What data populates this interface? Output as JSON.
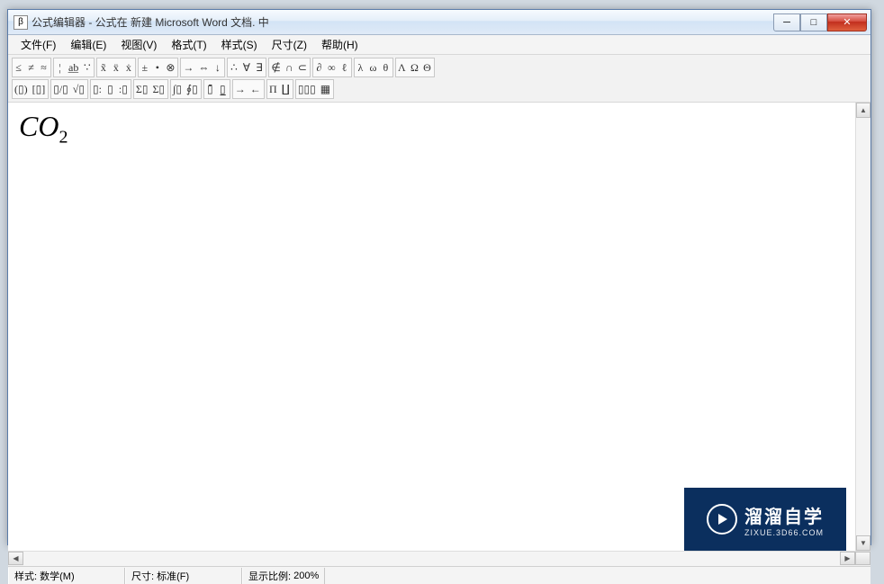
{
  "titlebar": {
    "icon_label": "formula-editor-icon",
    "title": "公式编辑器 - 公式在 新建 Microsoft Word 文档. 中"
  },
  "menubar": {
    "items": [
      {
        "label": "文件(F)"
      },
      {
        "label": "编辑(E)"
      },
      {
        "label": "视图(V)"
      },
      {
        "label": "格式(T)"
      },
      {
        "label": "样式(S)"
      },
      {
        "label": "尺寸(Z)"
      },
      {
        "label": "帮助(H)"
      }
    ]
  },
  "toolbar": {
    "row1": [
      {
        "name": "relational-ops",
        "symbols": [
          "≤",
          "≠",
          "≈"
        ]
      },
      {
        "name": "spaces-dots",
        "symbols": [
          "¦",
          "a̲b̲",
          "∵"
        ]
      },
      {
        "name": "embellishments",
        "symbols": [
          "x̃",
          "ẍ",
          "ẋ"
        ]
      },
      {
        "name": "operator-symbols",
        "symbols": [
          "±",
          "•",
          "⊗"
        ]
      },
      {
        "name": "arrows",
        "symbols": [
          "→",
          "⇔",
          "↓"
        ]
      },
      {
        "name": "logical",
        "symbols": [
          "∴",
          "∀",
          "∃"
        ]
      },
      {
        "name": "set-theory",
        "symbols": [
          "∉",
          "∩",
          "⊂"
        ]
      },
      {
        "name": "misc-symbols",
        "symbols": [
          "∂",
          "∞",
          "ℓ"
        ]
      },
      {
        "name": "greek-lower",
        "symbols": [
          "λ",
          "ω",
          "θ"
        ]
      },
      {
        "name": "greek-upper",
        "symbols": [
          "Λ",
          "Ω",
          "Θ"
        ]
      }
    ],
    "row2": [
      {
        "name": "fences",
        "symbols": [
          "(▯)",
          "[▯]"
        ]
      },
      {
        "name": "fractions-radicals",
        "symbols": [
          "▯/▯",
          "√▯"
        ]
      },
      {
        "name": "sub-super",
        "symbols": [
          "▯:",
          "▯",
          ":▯"
        ]
      },
      {
        "name": "summation",
        "symbols": [
          "Σ▯",
          "Σ▯"
        ]
      },
      {
        "name": "integral",
        "symbols": [
          "∫▯",
          "∮▯"
        ]
      },
      {
        "name": "bars",
        "symbols": [
          "▯̄",
          "▯̲"
        ]
      },
      {
        "name": "labeled-arrows",
        "symbols": [
          "→",
          "←"
        ]
      },
      {
        "name": "products",
        "symbols": [
          "Π",
          "∐"
        ]
      },
      {
        "name": "matrices",
        "symbols": [
          "▯▯▯",
          "▦"
        ]
      }
    ]
  },
  "content": {
    "formula_base": "CO",
    "formula_sub": "2"
  },
  "statusbar": {
    "style_label": "样式:",
    "style_value": "数学(M)",
    "size_label": "尺寸:",
    "size_value": "标准(F)",
    "zoom_label": "显示比例:",
    "zoom_value": "200%"
  },
  "watermark": {
    "title": "溜溜自学",
    "subtitle": "ZIXUE.3D66.COM"
  }
}
